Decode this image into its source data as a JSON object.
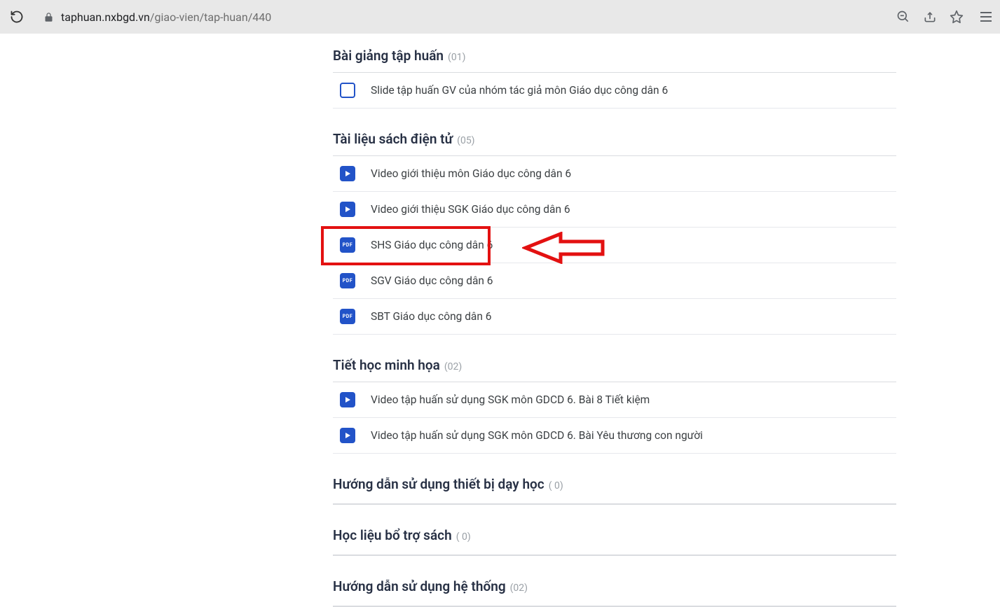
{
  "browser": {
    "url_host": "taphuan.nxbgd.vn",
    "url_path": "/giao-vien/tap-huan/440"
  },
  "sections": [
    {
      "title": "Bài giảng tập huấn",
      "count": "(01)",
      "items": [
        {
          "icon": "slide",
          "label": "Slide tập huấn GV của nhóm tác giả môn Giáo dục công dân 6"
        }
      ]
    },
    {
      "title": "Tài liệu sách điện tử",
      "count": "(05)",
      "items": [
        {
          "icon": "video",
          "label": "Video giới thiệu môn Giáo dục công dân 6"
        },
        {
          "icon": "video",
          "label": "Video giới thiệu SGK Giáo dục công dân 6"
        },
        {
          "icon": "pdf",
          "label": "SHS Giáo dục công dân 6",
          "highlighted": true
        },
        {
          "icon": "pdf",
          "label": "SGV Giáo dục công dân 6"
        },
        {
          "icon": "pdf",
          "label": "SBT Giáo dục công dân 6"
        }
      ]
    },
    {
      "title": "Tiết học minh họa",
      "count": "(02)",
      "items": [
        {
          "icon": "video",
          "label": "Video tập huấn sử dụng SGK môn GDCD 6. Bài 8 Tiết kiệm"
        },
        {
          "icon": "video",
          "label": "Video tập huấn sử dụng SGK môn GDCD 6. Bài Yêu thương con người"
        }
      ]
    },
    {
      "title": "Hướng dẫn sử dụng thiết bị dạy học",
      "count": "( 0)",
      "items": []
    },
    {
      "title": "Học liệu bổ trợ sách",
      "count": "( 0)",
      "items": []
    },
    {
      "title": "Hướng dẫn sử dụng hệ thống",
      "count": "(02)",
      "items": []
    }
  ],
  "icon_names": {
    "slide": "slide-icon",
    "video": "video-icon",
    "pdf": "pdf-icon"
  },
  "pdf_label": "PDF"
}
